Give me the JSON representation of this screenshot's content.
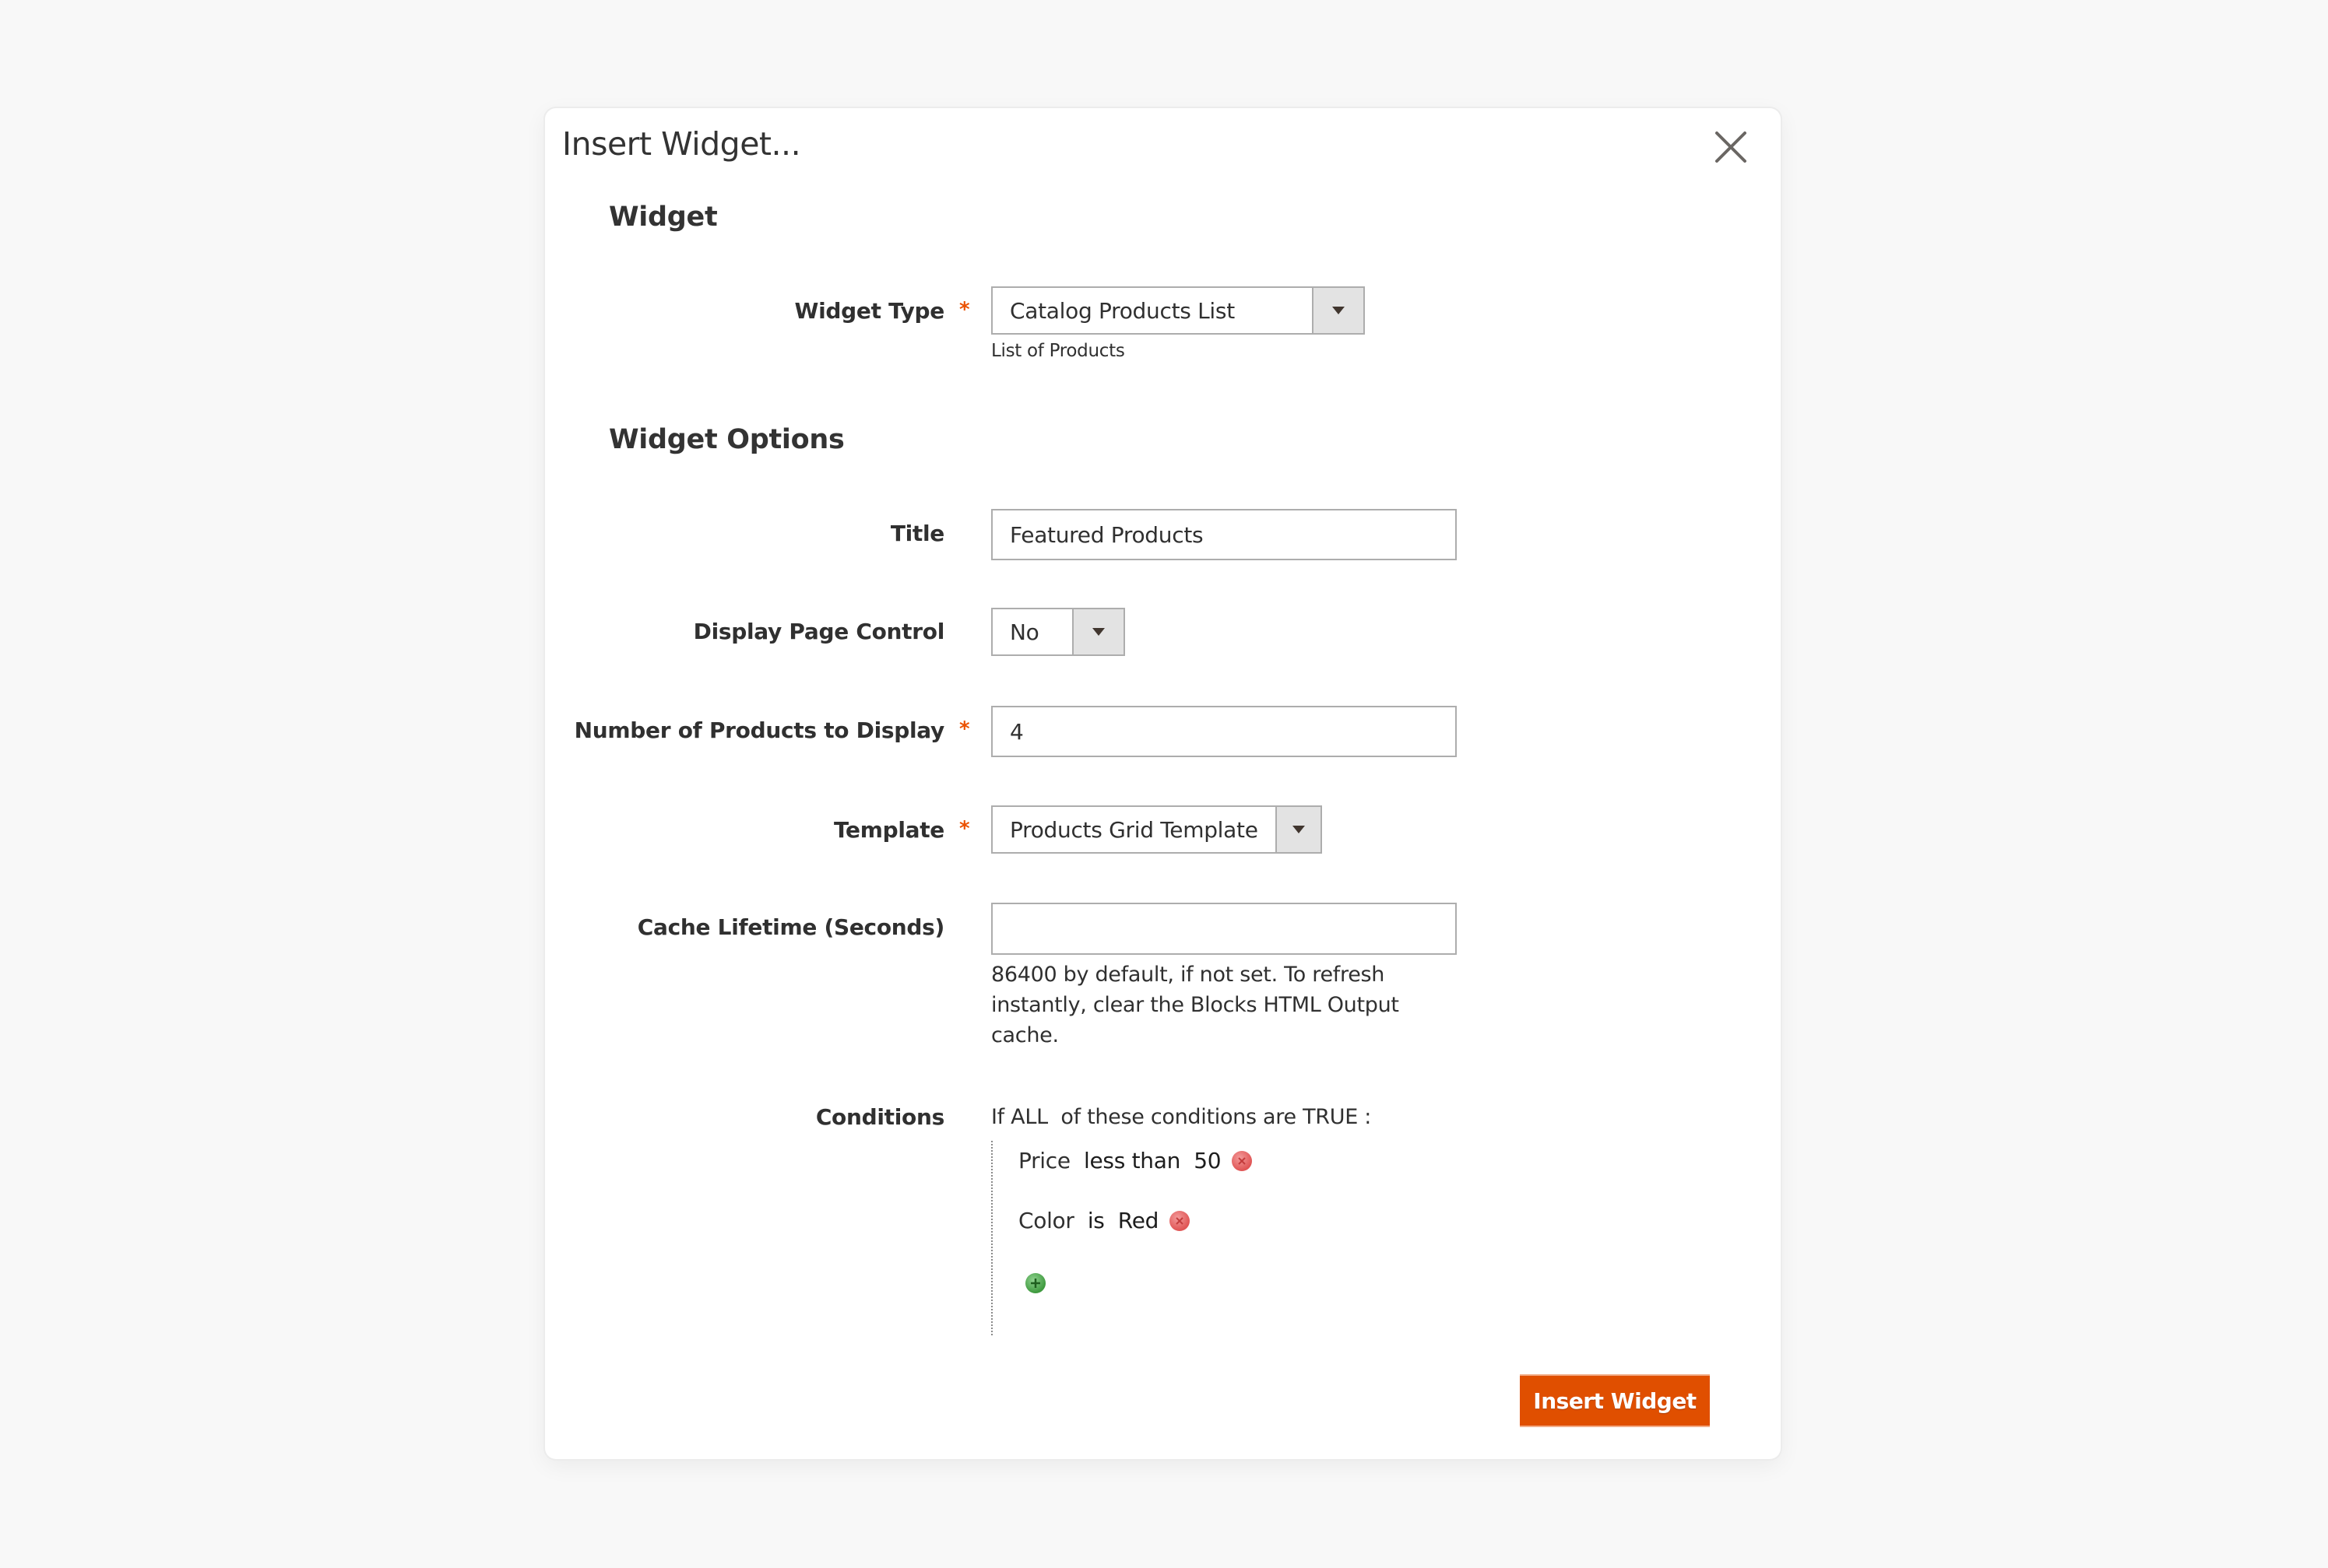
{
  "modal": {
    "title": "Insert Widget...",
    "close_icon": "close-icon"
  },
  "sections": {
    "widget": "Widget",
    "options": "Widget Options"
  },
  "widget_type": {
    "label": "Widget Type",
    "required": "*",
    "value": "Catalog Products List",
    "note": "List of Products"
  },
  "fields": {
    "title": {
      "label": "Title",
      "value": "Featured Products"
    },
    "display_page_control": {
      "label": "Display Page Control",
      "value": "No"
    },
    "number_of_products": {
      "label": "Number of Products to Display",
      "required": "*",
      "value": "4"
    },
    "template": {
      "label": "Template",
      "required": "*",
      "value": "Products Grid Template"
    },
    "cache_lifetime": {
      "label": "Cache Lifetime (Seconds)",
      "value": "",
      "note": "86400 by default, if not set. To refresh instantly, clear the Blocks HTML Output cache."
    }
  },
  "conditions": {
    "label": "Conditions",
    "header_prefix": "If ",
    "aggregator": "ALL",
    "header_middle": "  of these conditions are ",
    "value": "TRUE",
    "header_suffix": " :",
    "items": [
      {
        "attribute": "Price",
        "operator": "less than",
        "value": "50"
      },
      {
        "attribute": "Color",
        "operator": "is",
        "value": "Red"
      }
    ],
    "remove_icon": "remove-icon",
    "add_icon": "add-icon"
  },
  "actions": {
    "insert_label": "Insert Widget"
  },
  "colors": {
    "accent": "#e04f00",
    "required_star": "#eb5202",
    "remove": "#e05555",
    "add": "#3f9a3f"
  }
}
